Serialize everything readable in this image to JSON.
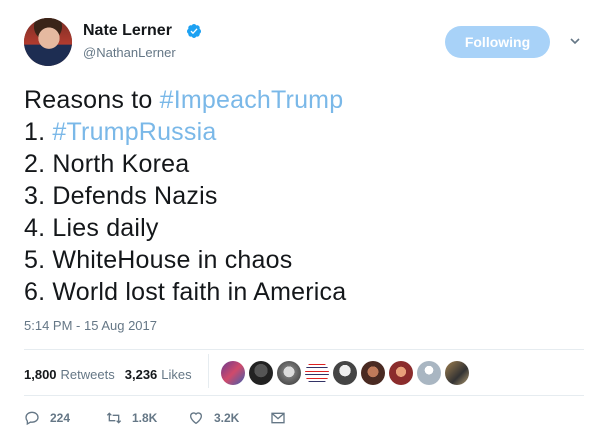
{
  "author": {
    "name": "Nate Lerner",
    "handle": "@NathanLerner"
  },
  "follow_button": {
    "label": "Following"
  },
  "tweet": {
    "lines": [
      {
        "parts": [
          "Reasons to ",
          "#ImpeachTrump"
        ]
      },
      {
        "parts": [
          "1. ",
          "#TrumpRussia"
        ]
      },
      {
        "text": "2. North Korea"
      },
      {
        "text": "3. Defends Nazis"
      },
      {
        "text": "4. Lies daily"
      },
      {
        "text": "5. WhiteHouse in chaos"
      },
      {
        "text": "6. World lost faith in America"
      }
    ]
  },
  "timestamp": "5:14 PM - 15 Aug 2017",
  "stats": {
    "retweets_count": "1,800",
    "retweets_label": "Retweets",
    "likes_count": "3,236",
    "likes_label": "Likes"
  },
  "actions": {
    "reply_count": "224",
    "retweet_count": "1.8K",
    "like_count": "3.2K"
  },
  "icons": {
    "verified": "verified-badge-icon",
    "chevron": "chevron-down-icon",
    "reply": "reply-icon",
    "retweet": "retweet-icon",
    "like": "heart-icon",
    "message": "envelope-icon"
  },
  "colors": {
    "hashtag": "#7ab8e8",
    "verified": "#1da1f2",
    "follow_button": "#a8d2f8"
  }
}
